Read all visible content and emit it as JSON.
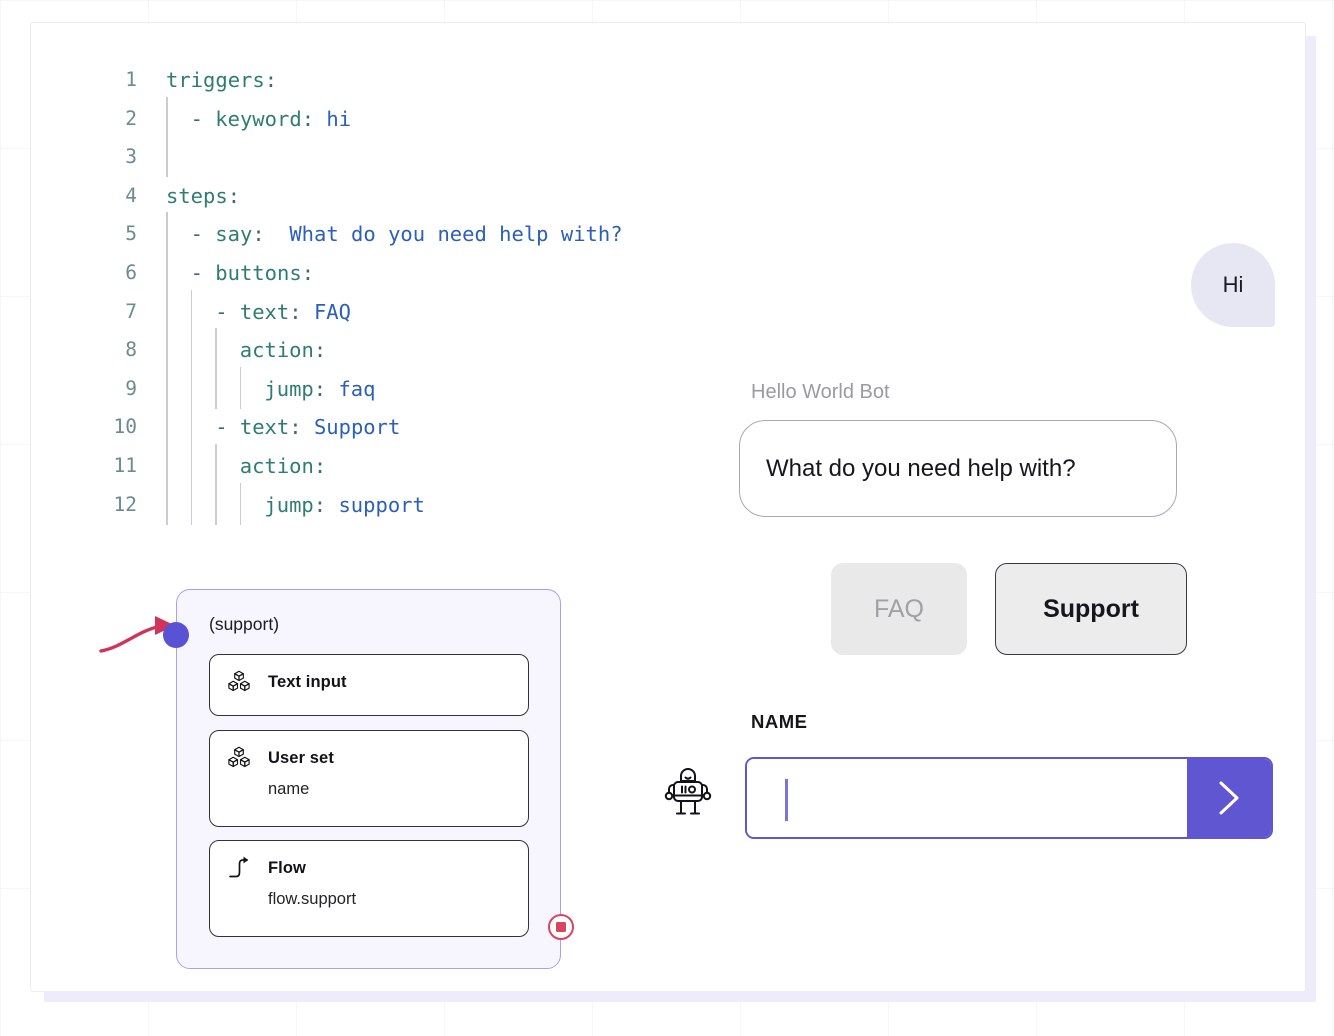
{
  "code_editor": {
    "language": "yaml",
    "lines": [
      {
        "num": "1",
        "indent": 0,
        "guides": 0,
        "tokens": [
          {
            "t": "triggers",
            "c": "k"
          },
          {
            "t": ":",
            "c": "d"
          }
        ]
      },
      {
        "num": "2",
        "indent": 1,
        "guides": 1,
        "tokens": [
          {
            "t": "- ",
            "c": "d"
          },
          {
            "t": "keyword",
            "c": "k"
          },
          {
            "t": ": ",
            "c": "d"
          },
          {
            "t": "hi",
            "c": "v"
          }
        ]
      },
      {
        "num": "3",
        "indent": 0,
        "guides": 1,
        "tokens": []
      },
      {
        "num": "4",
        "indent": 0,
        "guides": 0,
        "tokens": [
          {
            "t": "steps",
            "c": "k"
          },
          {
            "t": ":",
            "c": "d"
          }
        ]
      },
      {
        "num": "5",
        "indent": 1,
        "guides": 1,
        "tokens": [
          {
            "t": "- ",
            "c": "d"
          },
          {
            "t": "say",
            "c": "k"
          },
          {
            "t": ":  ",
            "c": "d"
          },
          {
            "t": "What do you need help with?",
            "c": "v"
          }
        ]
      },
      {
        "num": "6",
        "indent": 1,
        "guides": 1,
        "tokens": [
          {
            "t": "- ",
            "c": "d"
          },
          {
            "t": "buttons",
            "c": "k"
          },
          {
            "t": ":",
            "c": "d"
          }
        ]
      },
      {
        "num": "7",
        "indent": 2,
        "guides": 2,
        "tokens": [
          {
            "t": "- ",
            "c": "d"
          },
          {
            "t": "text",
            "c": "k"
          },
          {
            "t": ": ",
            "c": "d"
          },
          {
            "t": "FAQ",
            "c": "v"
          }
        ]
      },
      {
        "num": "8",
        "indent": 3,
        "guides": 3,
        "tokens": [
          {
            "t": "action",
            "c": "k"
          },
          {
            "t": ":",
            "c": "d"
          }
        ]
      },
      {
        "num": "9",
        "indent": 4,
        "guides": 4,
        "tokens": [
          {
            "t": "jump",
            "c": "k"
          },
          {
            "t": ": ",
            "c": "d"
          },
          {
            "t": "faq",
            "c": "v"
          }
        ]
      },
      {
        "num": "10",
        "indent": 2,
        "guides": 2,
        "tokens": [
          {
            "t": "- ",
            "c": "d"
          },
          {
            "t": "text",
            "c": "k"
          },
          {
            "t": ": ",
            "c": "d"
          },
          {
            "t": "Support",
            "c": "v"
          }
        ]
      },
      {
        "num": "11",
        "indent": 3,
        "guides": 3,
        "tokens": [
          {
            "t": "action",
            "c": "k"
          },
          {
            "t": ":",
            "c": "d"
          }
        ]
      },
      {
        "num": "12",
        "indent": 4,
        "guides": 4,
        "tokens": [
          {
            "t": "jump",
            "c": "k"
          },
          {
            "t": ": ",
            "c": "d"
          },
          {
            "t": "support",
            "c": "v"
          }
        ]
      }
    ]
  },
  "flow_node": {
    "title": "(support)",
    "start_dot_color": "#5a52d5",
    "border_color": "#a9a2e8",
    "background_color": "#f7f6fe",
    "stop_badge_color": "#d9445f",
    "incoming_arrow_color": "#d2335a",
    "cards": [
      {
        "icon": "cubes-icon",
        "label": "Text input",
        "sub": ""
      },
      {
        "icon": "cubes-icon",
        "label": "User set",
        "sub": "name"
      },
      {
        "icon": "flow-arrow-icon",
        "label": "Flow",
        "sub": "flow.support"
      }
    ]
  },
  "chat_preview": {
    "user_message": "Hi",
    "bot_name": "Hello World Bot",
    "bot_message": "What do you need help with?",
    "quick_replies": [
      {
        "label": "FAQ",
        "state": "muted"
      },
      {
        "label": "Support",
        "state": "selected"
      }
    ],
    "name_field": {
      "label": "NAME",
      "value": "",
      "placeholder": "",
      "accent_color": "#6156d1",
      "submit_icon": "chevron-right-icon"
    },
    "avatar_icon": "robot-icon"
  }
}
